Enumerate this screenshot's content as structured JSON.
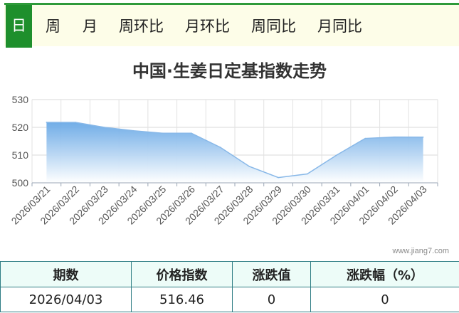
{
  "tabs": [
    {
      "label": "日",
      "active": true
    },
    {
      "label": "周",
      "active": false
    },
    {
      "label": "月",
      "active": false
    },
    {
      "label": "周环比",
      "active": false
    },
    {
      "label": "月环比",
      "active": false
    },
    {
      "label": "周同比",
      "active": false
    },
    {
      "label": "月同比",
      "active": false
    }
  ],
  "chart_data": {
    "type": "area",
    "title": "中国·生姜日定基指数走势",
    "x": [
      "2026/03/21",
      "2026/03/22",
      "2026/03/23",
      "2026/03/24",
      "2026/03/25",
      "2026/03/26",
      "2026/03/27",
      "2026/03/28",
      "2026/03/29",
      "2026/03/30",
      "2026/03/31",
      "2026/04/01",
      "2026/04/02",
      "2026/04/03"
    ],
    "values": [
      521.8,
      521.8,
      520.0,
      518.8,
      517.9,
      517.9,
      512.8,
      505.9,
      501.9,
      503.2,
      509.9,
      516.0,
      516.5,
      516.46
    ],
    "ylim": [
      500,
      530
    ],
    "yticks": [
      "530",
      "520",
      "510",
      "500"
    ],
    "grid": true,
    "colors": {
      "line": "#88b8e8",
      "fill_top": "#6aa9e6",
      "fill_bottom": "#ffffff"
    }
  },
  "watermark": "www.jiang7.com",
  "table": {
    "headers": [
      "期数",
      "价格指数",
      "涨跌值",
      "涨跌幅（%）"
    ],
    "rows": [
      [
        "2026/04/03",
        "516.46",
        "0",
        "0"
      ]
    ]
  },
  "colors": {
    "accent": "#1e8f2c",
    "tab_bg": "#fdfde8",
    "table_border": "#2e7d84",
    "table_header_bg": "#edfcf8"
  }
}
